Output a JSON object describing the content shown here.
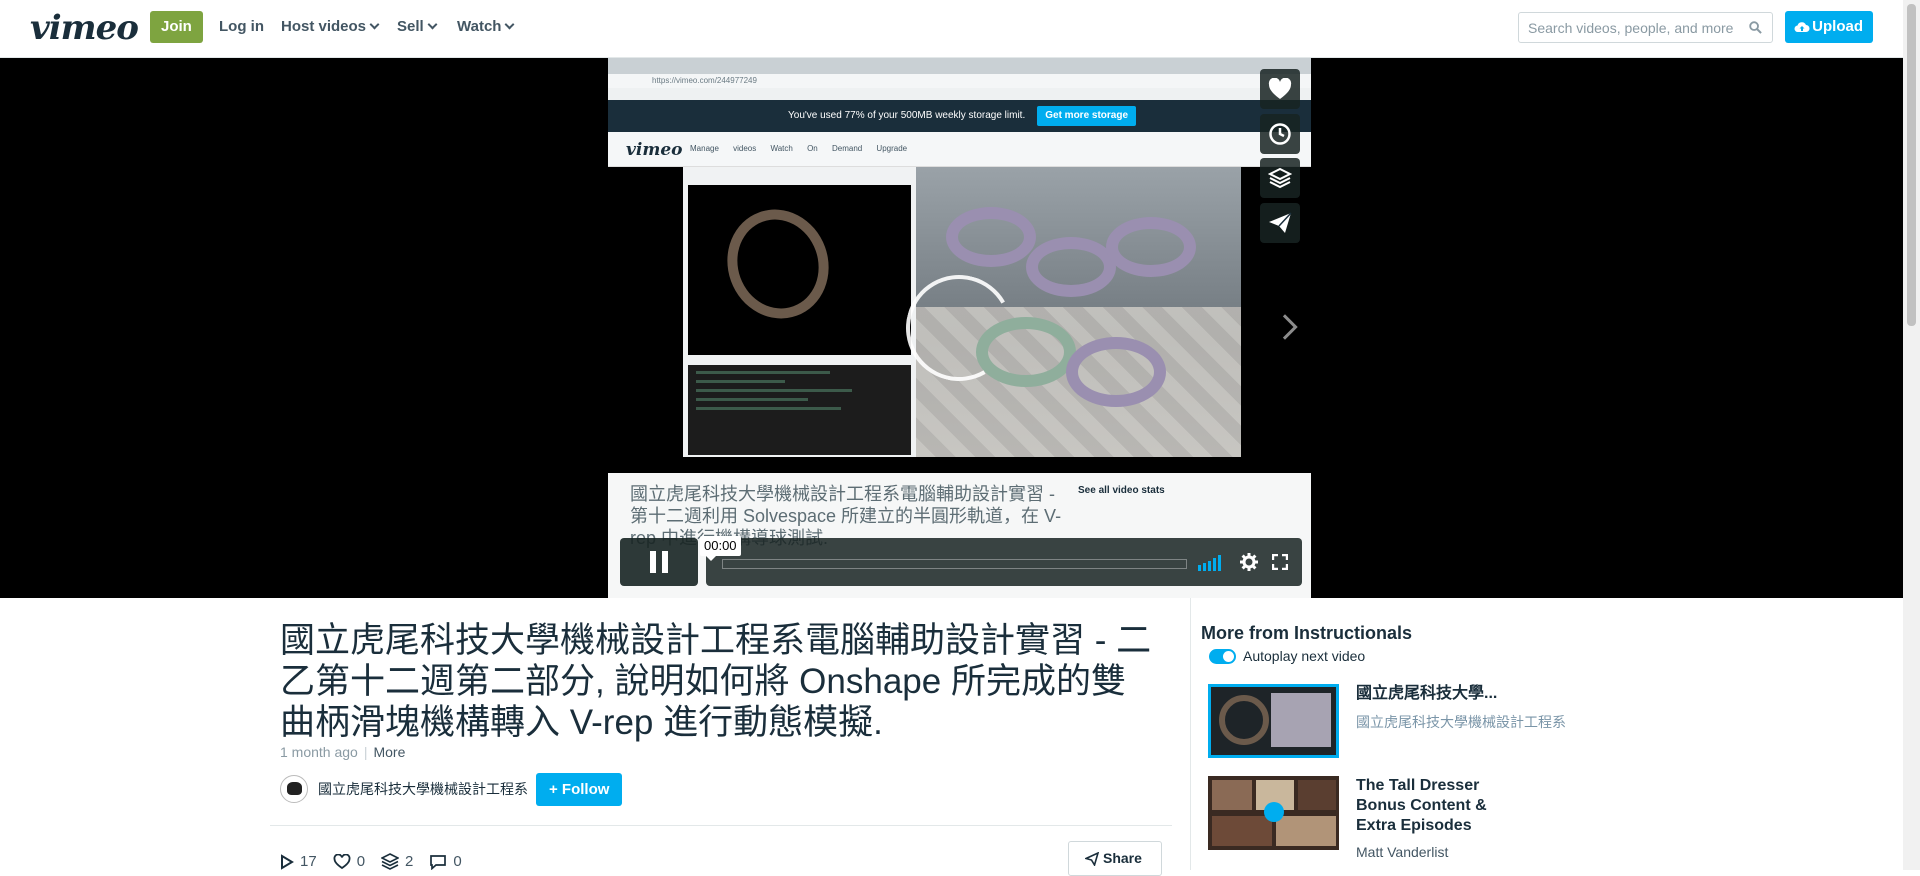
{
  "nav": {
    "logo": "vimeo",
    "join": "Join",
    "login": "Log in",
    "host_videos": "Host videos",
    "sell": "Sell",
    "watch": "Watch",
    "search_placeholder": "Search videos, people, and more",
    "upload": "Upload"
  },
  "player": {
    "timecode": "00:00",
    "side_buttons": [
      "heart-icon",
      "clock-icon",
      "layers-icon",
      "paper-plane-icon"
    ],
    "embedded": {
      "address": "https://vimeo.com/244977249",
      "storage_notice": "You've used 77% of your 500MB weekly storage limit.",
      "storage_button": "Get more storage",
      "logo": "vimeo",
      "menu": "Manage videos Watch On Demand Upgrade",
      "title": "國立虎尾科技大學機械設計工程系電腦輔助設計實習 - 第十二週利用 Solvespace 所建立的半圓形軌道，在 V-rep 中進行機構導球測試.",
      "stats": "See all video stats"
    }
  },
  "clip": {
    "title": "國立虎尾科技大學機械設計工程系電腦輔助設計實習 - 二乙第十二週第二部分, 說明如何將 Onshape 所完成的雙曲柄滑塊機構轉入 V-rep 進行動態模擬.",
    "posted": "1 month ago",
    "more": "More",
    "owner": "國立虎尾科技大學機械設計工程系",
    "follow": "+ Follow",
    "stats": {
      "plays": "17",
      "likes": "0",
      "collections": "2",
      "comments": "0"
    },
    "share": "Share"
  },
  "sidebar": {
    "heading": "More from Instructionals",
    "autoplay_label": "Autoplay next video",
    "items": [
      {
        "title": "國立虎尾科技大學...",
        "subtitle": "國立虎尾科技大學機械設計工程系"
      },
      {
        "title": "The Tall Dresser Bonus Content & Extra Episodes",
        "subtitle": "Matt Vanderlist"
      }
    ]
  },
  "colors": {
    "brand_blue": "#00adef",
    "join_green": "#7ea440",
    "text_dark": "#1a2e3b"
  }
}
